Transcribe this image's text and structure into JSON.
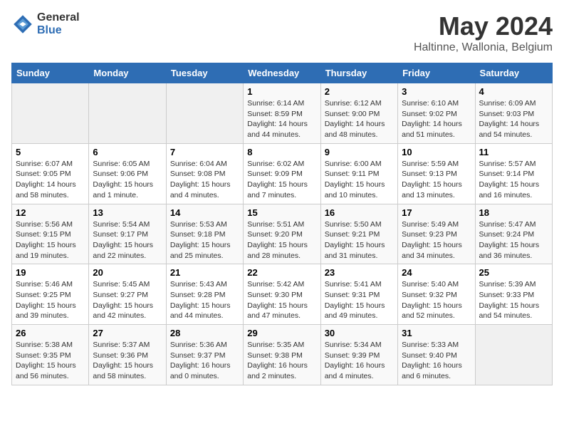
{
  "header": {
    "logo_general": "General",
    "logo_blue": "Blue",
    "main_title": "May 2024",
    "sub_title": "Haltinne, Wallonia, Belgium"
  },
  "weekdays": [
    "Sunday",
    "Monday",
    "Tuesday",
    "Wednesday",
    "Thursday",
    "Friday",
    "Saturday"
  ],
  "rows": [
    [
      {
        "day": "",
        "info": ""
      },
      {
        "day": "",
        "info": ""
      },
      {
        "day": "",
        "info": ""
      },
      {
        "day": "1",
        "info": "Sunrise: 6:14 AM\nSunset: 8:59 PM\nDaylight: 14 hours\nand 44 minutes."
      },
      {
        "day": "2",
        "info": "Sunrise: 6:12 AM\nSunset: 9:00 PM\nDaylight: 14 hours\nand 48 minutes."
      },
      {
        "day": "3",
        "info": "Sunrise: 6:10 AM\nSunset: 9:02 PM\nDaylight: 14 hours\nand 51 minutes."
      },
      {
        "day": "4",
        "info": "Sunrise: 6:09 AM\nSunset: 9:03 PM\nDaylight: 14 hours\nand 54 minutes."
      }
    ],
    [
      {
        "day": "5",
        "info": "Sunrise: 6:07 AM\nSunset: 9:05 PM\nDaylight: 14 hours\nand 58 minutes."
      },
      {
        "day": "6",
        "info": "Sunrise: 6:05 AM\nSunset: 9:06 PM\nDaylight: 15 hours\nand 1 minute."
      },
      {
        "day": "7",
        "info": "Sunrise: 6:04 AM\nSunset: 9:08 PM\nDaylight: 15 hours\nand 4 minutes."
      },
      {
        "day": "8",
        "info": "Sunrise: 6:02 AM\nSunset: 9:09 PM\nDaylight: 15 hours\nand 7 minutes."
      },
      {
        "day": "9",
        "info": "Sunrise: 6:00 AM\nSunset: 9:11 PM\nDaylight: 15 hours\nand 10 minutes."
      },
      {
        "day": "10",
        "info": "Sunrise: 5:59 AM\nSunset: 9:13 PM\nDaylight: 15 hours\nand 13 minutes."
      },
      {
        "day": "11",
        "info": "Sunrise: 5:57 AM\nSunset: 9:14 PM\nDaylight: 15 hours\nand 16 minutes."
      }
    ],
    [
      {
        "day": "12",
        "info": "Sunrise: 5:56 AM\nSunset: 9:15 PM\nDaylight: 15 hours\nand 19 minutes."
      },
      {
        "day": "13",
        "info": "Sunrise: 5:54 AM\nSunset: 9:17 PM\nDaylight: 15 hours\nand 22 minutes."
      },
      {
        "day": "14",
        "info": "Sunrise: 5:53 AM\nSunset: 9:18 PM\nDaylight: 15 hours\nand 25 minutes."
      },
      {
        "day": "15",
        "info": "Sunrise: 5:51 AM\nSunset: 9:20 PM\nDaylight: 15 hours\nand 28 minutes."
      },
      {
        "day": "16",
        "info": "Sunrise: 5:50 AM\nSunset: 9:21 PM\nDaylight: 15 hours\nand 31 minutes."
      },
      {
        "day": "17",
        "info": "Sunrise: 5:49 AM\nSunset: 9:23 PM\nDaylight: 15 hours\nand 34 minutes."
      },
      {
        "day": "18",
        "info": "Sunrise: 5:47 AM\nSunset: 9:24 PM\nDaylight: 15 hours\nand 36 minutes."
      }
    ],
    [
      {
        "day": "19",
        "info": "Sunrise: 5:46 AM\nSunset: 9:25 PM\nDaylight: 15 hours\nand 39 minutes."
      },
      {
        "day": "20",
        "info": "Sunrise: 5:45 AM\nSunset: 9:27 PM\nDaylight: 15 hours\nand 42 minutes."
      },
      {
        "day": "21",
        "info": "Sunrise: 5:43 AM\nSunset: 9:28 PM\nDaylight: 15 hours\nand 44 minutes."
      },
      {
        "day": "22",
        "info": "Sunrise: 5:42 AM\nSunset: 9:30 PM\nDaylight: 15 hours\nand 47 minutes."
      },
      {
        "day": "23",
        "info": "Sunrise: 5:41 AM\nSunset: 9:31 PM\nDaylight: 15 hours\nand 49 minutes."
      },
      {
        "day": "24",
        "info": "Sunrise: 5:40 AM\nSunset: 9:32 PM\nDaylight: 15 hours\nand 52 minutes."
      },
      {
        "day": "25",
        "info": "Sunrise: 5:39 AM\nSunset: 9:33 PM\nDaylight: 15 hours\nand 54 minutes."
      }
    ],
    [
      {
        "day": "26",
        "info": "Sunrise: 5:38 AM\nSunset: 9:35 PM\nDaylight: 15 hours\nand 56 minutes."
      },
      {
        "day": "27",
        "info": "Sunrise: 5:37 AM\nSunset: 9:36 PM\nDaylight: 15 hours\nand 58 minutes."
      },
      {
        "day": "28",
        "info": "Sunrise: 5:36 AM\nSunset: 9:37 PM\nDaylight: 16 hours\nand 0 minutes."
      },
      {
        "day": "29",
        "info": "Sunrise: 5:35 AM\nSunset: 9:38 PM\nDaylight: 16 hours\nand 2 minutes."
      },
      {
        "day": "30",
        "info": "Sunrise: 5:34 AM\nSunset: 9:39 PM\nDaylight: 16 hours\nand 4 minutes."
      },
      {
        "day": "31",
        "info": "Sunrise: 5:33 AM\nSunset: 9:40 PM\nDaylight: 16 hours\nand 6 minutes."
      },
      {
        "day": "",
        "info": ""
      }
    ]
  ]
}
